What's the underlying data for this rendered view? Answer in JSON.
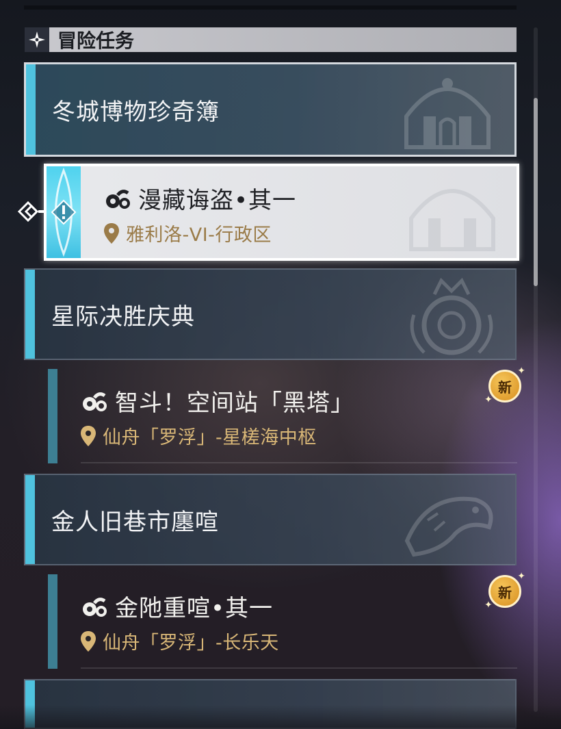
{
  "section": {
    "title": "冒险任务",
    "icon": "four-point-star-icon"
  },
  "groups": [
    {
      "title": "冬城博物珍奇簿",
      "emblem": "palace-emblem-icon",
      "state": "expanded"
    },
    {
      "title": "星际决胜庆典",
      "emblem": "laurel-crown-emblem-icon",
      "state": "expanded"
    },
    {
      "title": "金人旧巷市廛喧",
      "emblem": "dragon-emblem-icon",
      "state": "expanded"
    },
    {
      "title": ""
    }
  ],
  "quests": [
    {
      "name": "漫藏诲盗•其一",
      "location": "雅利洛-VI-行政区",
      "selected": true,
      "badge": ""
    },
    {
      "name": "智斗！空间站「黑塔」",
      "location": "仙舟「罗浮」-星槎海中枢",
      "selected": false,
      "badge": "新"
    },
    {
      "name": "金阤重喧•其一",
      "location": "仙舟「罗浮」-长乐天",
      "selected": false,
      "badge": "新"
    }
  ],
  "colors": {
    "accent": "#4fc2de",
    "location_text": "#d9b777",
    "badge": "#e9a437"
  }
}
